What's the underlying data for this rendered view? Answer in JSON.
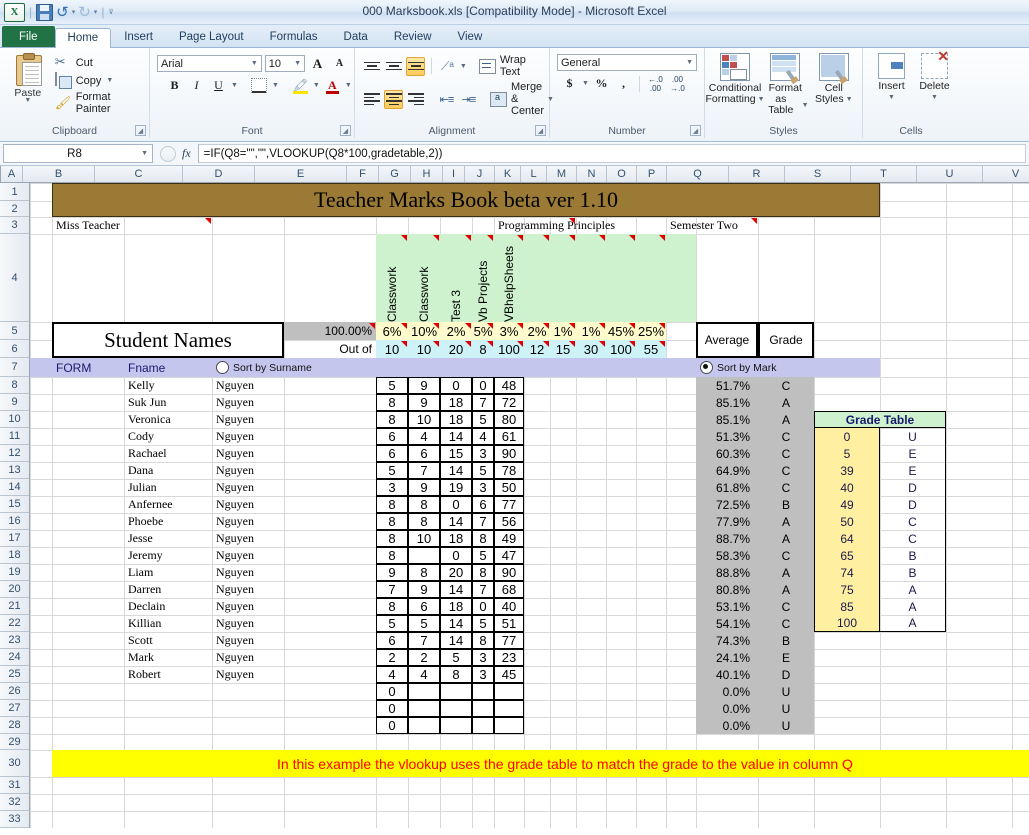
{
  "window": {
    "title": "000 Marksbook.xls  [Compatibility Mode]  -  Microsoft Excel"
  },
  "quick_access": {
    "excel_logo": "X",
    "save": "save-icon",
    "undo": "↰",
    "redo": "↱",
    "customize": "▼"
  },
  "ribbon": {
    "tabs": [
      {
        "label": "File",
        "kind": "file"
      },
      {
        "label": "Home",
        "kind": "active"
      },
      {
        "label": "Insert",
        "kind": "normal"
      },
      {
        "label": "Page Layout",
        "kind": "normal"
      },
      {
        "label": "Formulas",
        "kind": "normal"
      },
      {
        "label": "Data",
        "kind": "normal"
      },
      {
        "label": "Review",
        "kind": "normal"
      },
      {
        "label": "View",
        "kind": "normal"
      }
    ],
    "groups": {
      "clipboard": {
        "label": "Clipboard",
        "paste": "Paste",
        "cut": "Cut",
        "copy": "Copy",
        "format_painter": "Format Painter"
      },
      "font": {
        "label": "Font",
        "font_name": "Arial",
        "font_size": "10",
        "bold": "B",
        "italic": "I",
        "underline": "U",
        "grow": "A",
        "shrink": "A"
      },
      "alignment": {
        "label": "Alignment",
        "wrap_text": "Wrap Text",
        "merge_center": "Merge & Center"
      },
      "number": {
        "label": "Number",
        "format": "General",
        "currency": "$",
        "percent": "%",
        "comma": ","
      },
      "styles": {
        "label": "Styles",
        "conditional_formatting": "Conditional\nFormatting",
        "conditional_formatting_l1": "Conditional",
        "conditional_formatting_l2": "Formatting",
        "format_as_table_l1": "Format",
        "format_as_table_l2": "as Table",
        "cell_styles_l1": "Cell",
        "cell_styles_l2": "Styles"
      },
      "cells": {
        "label": "Cells",
        "insert": "Insert",
        "delete": "Delete"
      }
    }
  },
  "formula_bar": {
    "name_box": "R8",
    "formula": "=IF(Q8=\"\",\"\",VLOOKUP(Q8*100,gradetable,2))",
    "fx": "fx"
  },
  "sheet": {
    "column_headers": [
      "A",
      "B",
      "C",
      "D",
      "E",
      "F",
      "G",
      "H",
      "I",
      "J",
      "K",
      "L",
      "M",
      "N",
      "O",
      "P",
      "Q",
      "R",
      "S",
      "T",
      "U",
      "V"
    ],
    "row_headers": [
      "1",
      "2",
      "3",
      "4",
      "5",
      "6",
      "7",
      "8",
      "9",
      "10",
      "11",
      "12",
      "13",
      "14",
      "15",
      "16",
      "17",
      "18",
      "19",
      "20",
      "21",
      "22",
      "23",
      "24",
      "25",
      "26",
      "27",
      "28",
      "29",
      "30",
      "31",
      "32",
      "33"
    ],
    "banner_title": "Teacher Marks Book beta ver 1.10",
    "teacher_name": "Miss Teacher",
    "subject": "Programming Principles",
    "semester": "Semester Two",
    "student_names_label": "Student Names",
    "total_percent": "100.00%",
    "out_of_label": "Out of",
    "average_label": "Average",
    "grade_label": "Grade",
    "assessment_titles": [
      "Classwork",
      "Classwork",
      "Test 3",
      "Vb Projects",
      "VBhelpSheets",
      "",
      "",
      "",
      "",
      ""
    ],
    "weights": [
      "6%",
      "10%",
      "2%",
      "5%",
      "3%",
      "2%",
      "1%",
      "1%",
      "45%",
      "25%"
    ],
    "out_of": [
      "10",
      "10",
      "20",
      "8",
      "100",
      "12",
      "15",
      "30",
      "100",
      "55"
    ],
    "header_row": {
      "form": "FORM",
      "fname": "Fname",
      "sort_by_surname": "Sort by Surname",
      "sort_by_mark": "Sort by Mark"
    },
    "students": [
      {
        "fname": "Kelly",
        "surname": "Nguyen",
        "marks": [
          "5",
          "9",
          "0",
          "0",
          "48"
        ],
        "average": "51.7%",
        "grade": "C"
      },
      {
        "fname": "Suk Jun",
        "surname": "Nguyen",
        "marks": [
          "8",
          "9",
          "18",
          "7",
          "72"
        ],
        "average": "85.1%",
        "grade": "A"
      },
      {
        "fname": "Veronica",
        "surname": "Nguyen",
        "marks": [
          "8",
          "10",
          "18",
          "5",
          "80"
        ],
        "average": "85.1%",
        "grade": "A"
      },
      {
        "fname": "Cody",
        "surname": "Nguyen",
        "marks": [
          "6",
          "4",
          "14",
          "4",
          "61"
        ],
        "average": "51.3%",
        "grade": "C"
      },
      {
        "fname": "Rachael",
        "surname": "Nguyen",
        "marks": [
          "6",
          "6",
          "15",
          "3",
          "90"
        ],
        "average": "60.3%",
        "grade": "C"
      },
      {
        "fname": "Dana",
        "surname": "Nguyen",
        "marks": [
          "5",
          "7",
          "14",
          "5",
          "78"
        ],
        "average": "64.9%",
        "grade": "C"
      },
      {
        "fname": "Julian",
        "surname": "Nguyen",
        "marks": [
          "3",
          "9",
          "19",
          "3",
          "50"
        ],
        "average": "61.8%",
        "grade": "C"
      },
      {
        "fname": "Anfernee",
        "surname": "Nguyen",
        "marks": [
          "8",
          "8",
          "0",
          "6",
          "77"
        ],
        "average": "72.5%",
        "grade": "B"
      },
      {
        "fname": "Phoebe",
        "surname": "Nguyen",
        "marks": [
          "8",
          "8",
          "14",
          "7",
          "56"
        ],
        "average": "77.9%",
        "grade": "A"
      },
      {
        "fname": "Jesse",
        "surname": "Nguyen",
        "marks": [
          "8",
          "10",
          "18",
          "8",
          "49"
        ],
        "average": "88.7%",
        "grade": "A"
      },
      {
        "fname": "Jeremy",
        "surname": "Nguyen",
        "marks": [
          "8",
          "",
          "0",
          "5",
          "47"
        ],
        "average": "58.3%",
        "grade": "C"
      },
      {
        "fname": "Liam",
        "surname": "Nguyen",
        "marks": [
          "9",
          "8",
          "20",
          "8",
          "90"
        ],
        "average": "88.8%",
        "grade": "A"
      },
      {
        "fname": "Darren",
        "surname": "Nguyen",
        "marks": [
          "7",
          "9",
          "14",
          "7",
          "68"
        ],
        "average": "80.8%",
        "grade": "A"
      },
      {
        "fname": "Declain",
        "surname": "Nguyen",
        "marks": [
          "8",
          "6",
          "18",
          "0",
          "40"
        ],
        "average": "53.1%",
        "grade": "C"
      },
      {
        "fname": "Killian",
        "surname": "Nguyen",
        "marks": [
          "5",
          "5",
          "14",
          "5",
          "51"
        ],
        "average": "54.1%",
        "grade": "C"
      },
      {
        "fname": "Scott",
        "surname": "Nguyen",
        "marks": [
          "6",
          "7",
          "14",
          "8",
          "77"
        ],
        "average": "74.3%",
        "grade": "B"
      },
      {
        "fname": "Mark",
        "surname": "Nguyen",
        "marks": [
          "2",
          "2",
          "5",
          "3",
          "23"
        ],
        "average": "24.1%",
        "grade": "E"
      },
      {
        "fname": "Robert",
        "surname": "Nguyen",
        "marks": [
          "4",
          "4",
          "8",
          "3",
          "45"
        ],
        "average": "40.1%",
        "grade": "D"
      },
      {
        "fname": "",
        "surname": "",
        "marks": [
          "0",
          "",
          "",
          "",
          ""
        ],
        "average": "0.0%",
        "grade": "U"
      },
      {
        "fname": "",
        "surname": "",
        "marks": [
          "0",
          "",
          "",
          "",
          ""
        ],
        "average": "0.0%",
        "grade": "U"
      },
      {
        "fname": "",
        "surname": "",
        "marks": [
          "0",
          "",
          "",
          "",
          ""
        ],
        "average": "0.0%",
        "grade": "U"
      }
    ],
    "grade_table": {
      "title": "Grade Table",
      "rows": [
        {
          "value": "0",
          "grade": "U"
        },
        {
          "value": "5",
          "grade": "E"
        },
        {
          "value": "39",
          "grade": "E"
        },
        {
          "value": "40",
          "grade": "D"
        },
        {
          "value": "49",
          "grade": "D"
        },
        {
          "value": "50",
          "grade": "C"
        },
        {
          "value": "64",
          "grade": "C"
        },
        {
          "value": "65",
          "grade": "B"
        },
        {
          "value": "74",
          "grade": "B"
        },
        {
          "value": "75",
          "grade": "A"
        },
        {
          "value": "85",
          "grade": "A"
        },
        {
          "value": "100",
          "grade": "A"
        }
      ]
    },
    "note": "In this example the vlookup uses the grade table to match the grade to the value in column Q"
  },
  "colors": {
    "banner": "#9a7a34",
    "header_green": "#cdf2cd",
    "weight_yellow": "#fffbcc",
    "outof_cyan": "#cdf3f8",
    "sortrow_lavender": "#c5c6ee",
    "result_gray": "#bfbfbf",
    "grade_table_yellow": "#ffefa0",
    "note_bg": "#ffff00",
    "note_fg": "#ff0000",
    "file_tab_green": "#217346"
  }
}
